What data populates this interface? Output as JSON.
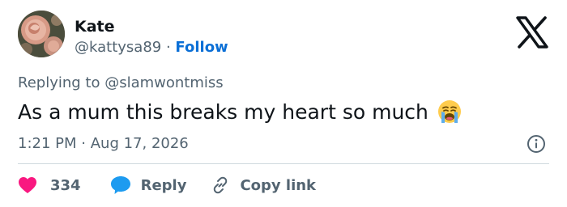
{
  "user": {
    "name": "Kate",
    "handle": "@kattysa89",
    "separator": "·",
    "follow_label": "Follow"
  },
  "tweet": {
    "replying_prefix": "Replying to",
    "replying_to": "@slamwontmiss",
    "text": "As a mum this breaks my heart so much",
    "emoji": "loudly-crying-face",
    "time": "1:21 PM",
    "date_separator": "·",
    "date": "Aug 17, 2026"
  },
  "actions": {
    "like_count": "334",
    "reply_label": "Reply",
    "copy_link_label": "Copy link"
  },
  "colors": {
    "text": "#0f1419",
    "secondary": "#536471",
    "link": "#0b6fd6",
    "like": "#f91880",
    "reply_bubble": "#1d9bf0",
    "divider": "#cfd9de"
  },
  "icons": [
    "avatar-rose",
    "x-logo",
    "loudly-crying-emoji",
    "info-icon",
    "heart-icon",
    "reply-bubble-icon",
    "link-icon"
  ]
}
